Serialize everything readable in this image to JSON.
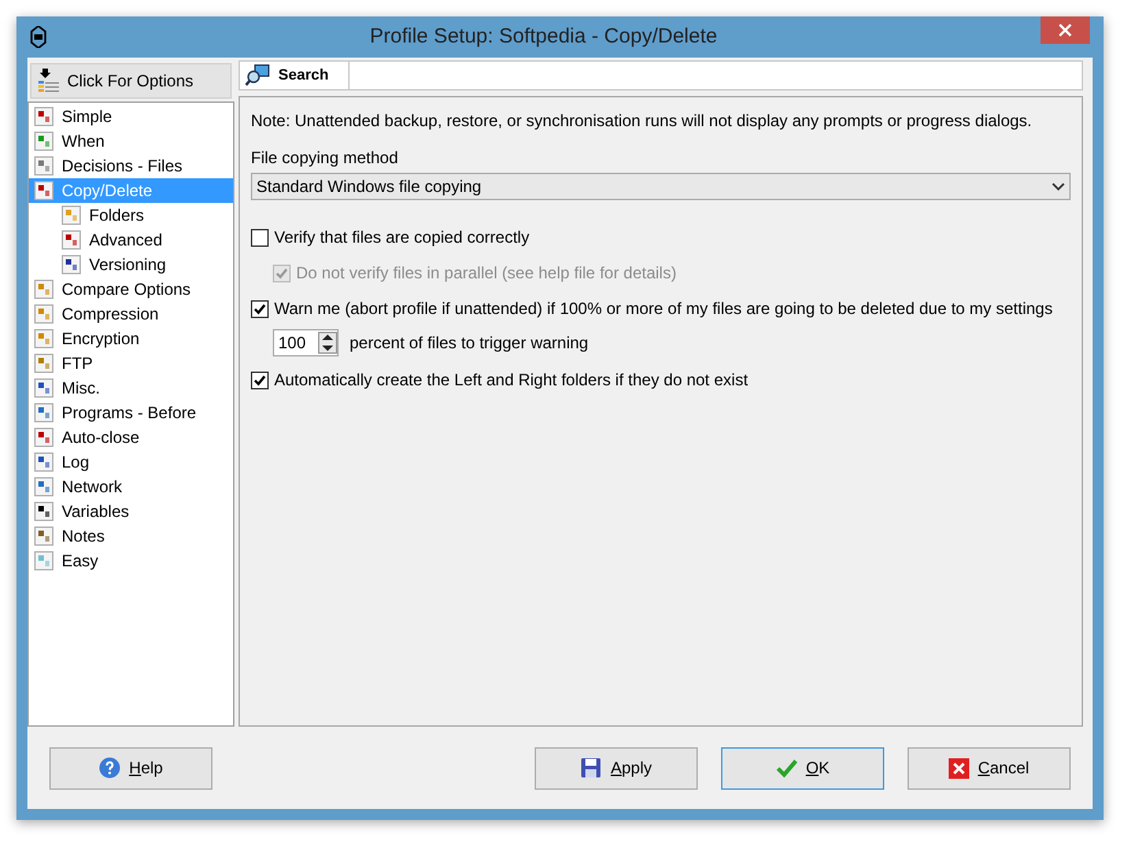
{
  "window": {
    "title": "Profile Setup: Softpedia - Copy/Delete"
  },
  "sidebar": {
    "options_button": "Click For Options",
    "items": [
      {
        "label": "Simple",
        "selected": false
      },
      {
        "label": "When",
        "selected": false
      },
      {
        "label": "Decisions - Files",
        "selected": false
      },
      {
        "label": "Copy/Delete",
        "selected": true,
        "children": [
          {
            "label": "Folders",
            "selected": false
          },
          {
            "label": "Advanced",
            "selected": false
          },
          {
            "label": "Versioning",
            "selected": false
          }
        ]
      },
      {
        "label": "Compare Options",
        "selected": false
      },
      {
        "label": "Compression",
        "selected": false
      },
      {
        "label": "Encryption",
        "selected": false
      },
      {
        "label": "FTP",
        "selected": false
      },
      {
        "label": "Misc.",
        "selected": false
      },
      {
        "label": "Programs - Before",
        "selected": false
      },
      {
        "label": "Auto-close",
        "selected": false
      },
      {
        "label": "Log",
        "selected": false
      },
      {
        "label": "Network",
        "selected": false
      },
      {
        "label": "Variables",
        "selected": false
      },
      {
        "label": "Notes",
        "selected": false
      },
      {
        "label": "Easy",
        "selected": false
      }
    ]
  },
  "tabs": [
    {
      "label": "Search",
      "selected": true
    }
  ],
  "note": "Note: Unattended backup, restore, or synchronisation runs will not display any prompts or progress dialogs.",
  "copy_method": {
    "label": "File copying method",
    "value": "Standard Windows file copying"
  },
  "options": [
    {
      "kind": "checkbox",
      "label": "Verify that files are copied correctly",
      "checked": false,
      "disabled": false,
      "children": [
        {
          "label": "Do not verify files in parallel (see help file for details)",
          "checked": true,
          "disabled": true
        }
      ]
    },
    {
      "kind": "checkbox",
      "label": "Warn me (abort profile if unattended) if 100% or more of my files are going to be deleted due to my settings",
      "checked": true,
      "disabled": false
    },
    {
      "kind": "spinner",
      "value": "100",
      "label": "percent of files to trigger warning"
    },
    {
      "kind": "checkbox",
      "label": "Automatically create the Left and Right folders if they do not exist",
      "checked": true,
      "disabled": false
    }
  ],
  "buttons": [
    {
      "kind": "help",
      "label": "Help",
      "focused": false
    },
    {
      "kind": "apply",
      "label": "Apply",
      "focused": false
    },
    {
      "kind": "ok",
      "label": "OK",
      "focused": true
    },
    {
      "kind": "cancel",
      "label": "Cancel",
      "focused": false
    }
  ]
}
